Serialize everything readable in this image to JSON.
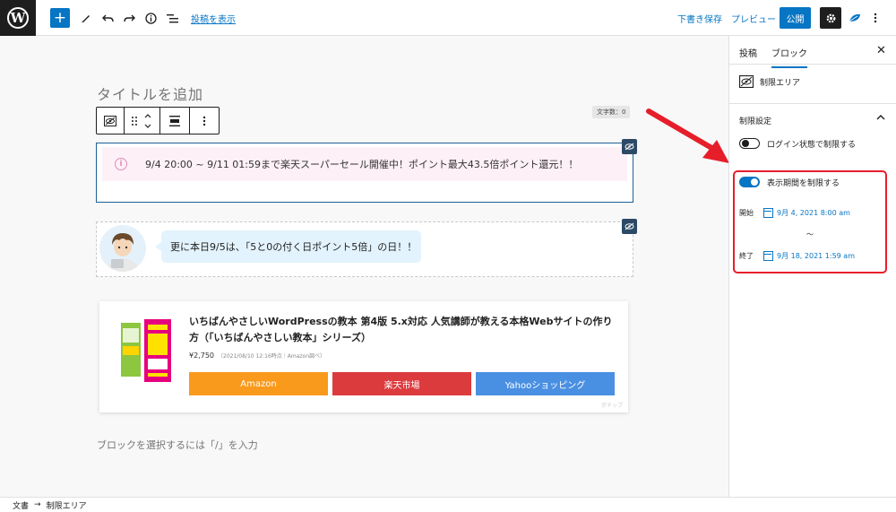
{
  "topbar": {
    "wp_logo": "W",
    "preview_post_link": "投稿を表示",
    "save_draft": "下書き保存",
    "preview": "プレビュー",
    "publish": "公開"
  },
  "editor": {
    "title_placeholder": "タイトルを追加",
    "char_count": "文字数：0",
    "notice_text": "9/4 20:00 ~ 9/11 01:59まで楽天スーパーセール開催中！ポイント最大43.5倍ポイント還元！！",
    "bubble_text": "更に本日9/5は、「5と0の付く日ポイント5倍」の日！！",
    "product": {
      "title": "いちばんやさしいWordPressの教本 第4版 5.x対応 人気講師が教える本格Webサイトの作り方（「いちばんやさしい教本」シリーズ）",
      "price": "¥2,750",
      "price_note": "（2021/08/10 12:16時点｜Amazon調べ）",
      "amazon": "Amazon",
      "rakuten": "楽天市場",
      "yahoo": "Yahooショッピング",
      "mark": "ポチップ"
    },
    "insert_placeholder": "ブロックを選択するには「/」を入力"
  },
  "sidebar": {
    "tab_post": "投稿",
    "tab_block": "ブロック",
    "block_name": "制限エリア",
    "panel_title": "制限設定",
    "login_toggle_label": "ログイン状態で制限する",
    "period_toggle_label": "表示期間を制限する",
    "start_label": "開始",
    "start_value": "9月 4, 2021 8:00 am",
    "separator": "～",
    "end_label": "終了",
    "end_value": "9月 18, 2021 1:59 am",
    "login_toggle_on": false,
    "period_toggle_on": true
  },
  "footer": {
    "crumb_root": "文書",
    "crumb_arrow": "→",
    "crumb_current": "制限エリア"
  },
  "colors": {
    "accent": "#0675c4",
    "amazon": "#f99a1c",
    "rakuten": "#dc3b3e",
    "yahoo": "#4a90e2",
    "highlight": "#e61e2a"
  }
}
